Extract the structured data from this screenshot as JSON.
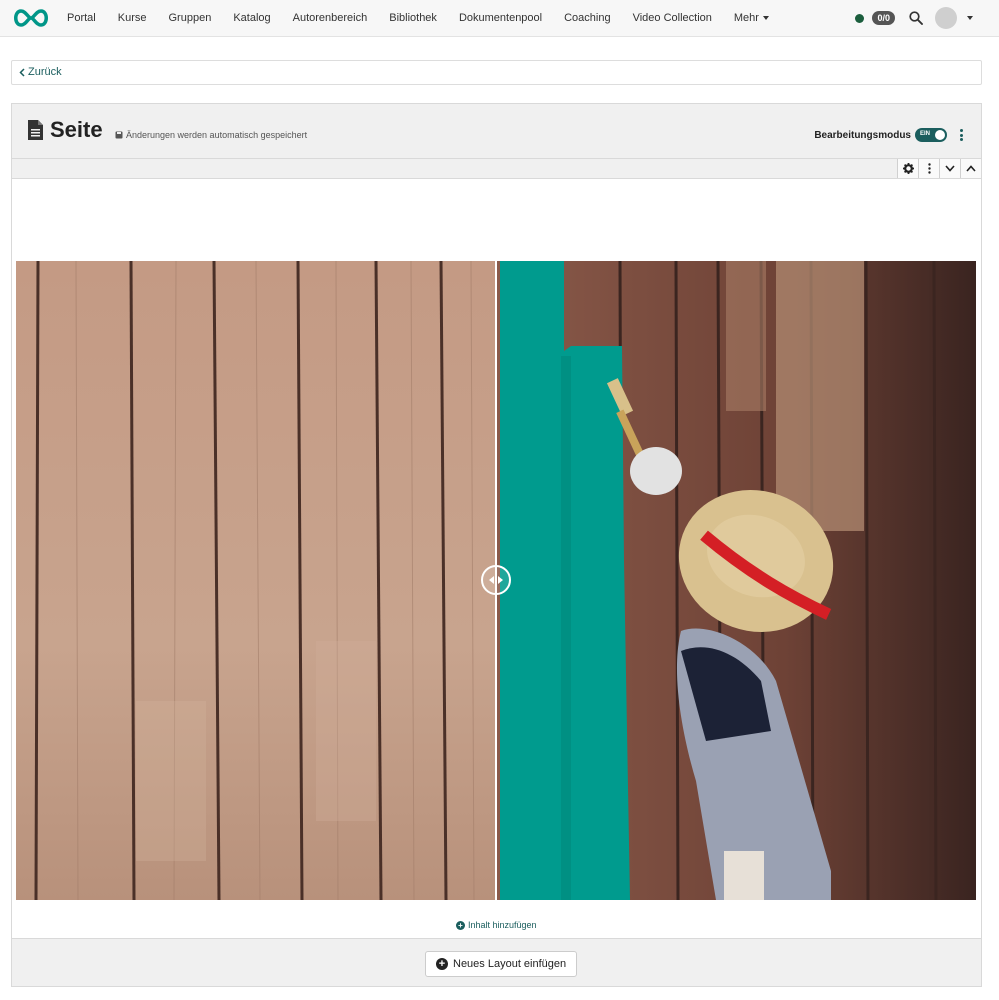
{
  "nav": {
    "items": [
      {
        "label": "Portal"
      },
      {
        "label": "Kurse"
      },
      {
        "label": "Gruppen"
      },
      {
        "label": "Katalog"
      },
      {
        "label": "Autorenbereich"
      },
      {
        "label": "Bibliothek"
      },
      {
        "label": "Dokumentenpool"
      },
      {
        "label": "Coaching"
      },
      {
        "label": "Video Collection"
      },
      {
        "label": "Mehr"
      }
    ],
    "badge": "0/0",
    "logo_icon": "infinity-logo-icon",
    "brand_color": "#009688",
    "status_color": "#1b5e3d"
  },
  "back": {
    "label": "Zurück"
  },
  "page": {
    "title": "Seite",
    "autosave_text": "Änderungen werden automatisch gespeichert",
    "edit_mode_label": "Bearbeitungsmodus",
    "toggle_text": "EIN",
    "accent_color": "#1b5e5e"
  },
  "compare": {
    "before_description_icon": "fence-before-image",
    "after_description_icon": "fence-after-image",
    "paint_color": "#009b8e"
  },
  "add_content": {
    "label": "Inhalt hinzufügen"
  },
  "footer": {
    "new_layout_label": "Neues Layout einfügen"
  }
}
